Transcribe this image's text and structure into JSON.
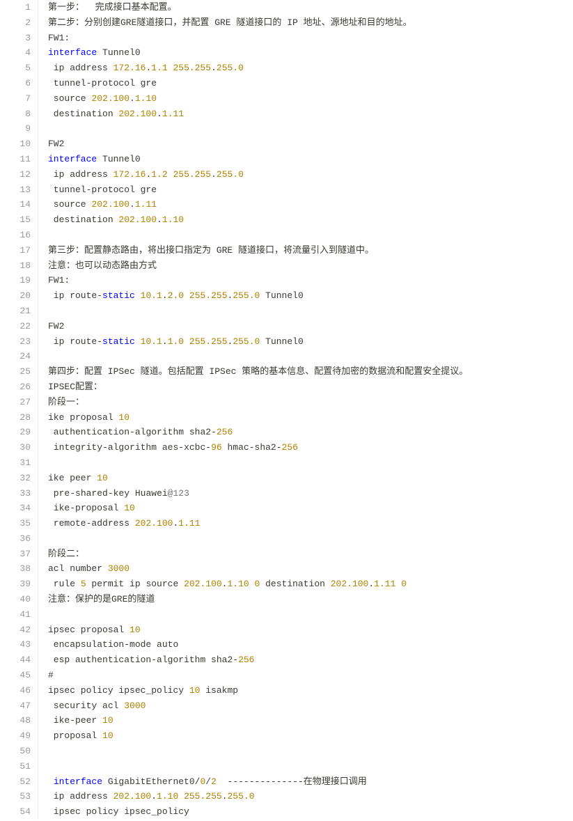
{
  "lines": [
    {
      "n": "1",
      "segs": [
        {
          "t": "第一步：  完成接口基本配置。"
        }
      ]
    },
    {
      "n": "2",
      "segs": [
        {
          "t": "第二步：分别创建GRE隧道接口，并配置 GRE 隧道接口的 IP 地址、源地址和目的地址。"
        }
      ]
    },
    {
      "n": "3",
      "segs": [
        {
          "t": "FW1"
        },
        {
          "t": ":",
          "c": "op"
        }
      ]
    },
    {
      "n": "4",
      "segs": [
        {
          "t": "interface",
          "c": "kw"
        },
        {
          "t": " Tunnel0"
        }
      ]
    },
    {
      "n": "5",
      "segs": [
        {
          "t": " ip address "
        },
        {
          "t": "172.16",
          "c": "num"
        },
        {
          "t": "."
        },
        {
          "t": "1.1",
          "c": "num"
        },
        {
          "t": " "
        },
        {
          "t": "255.255",
          "c": "num"
        },
        {
          "t": "."
        },
        {
          "t": "255.0",
          "c": "num"
        }
      ]
    },
    {
      "n": "6",
      "segs": [
        {
          "t": " tunnel"
        },
        {
          "t": "-"
        },
        {
          "t": "protocol gre"
        }
      ]
    },
    {
      "n": "7",
      "segs": [
        {
          "t": " source "
        },
        {
          "t": "202.100",
          "c": "num"
        },
        {
          "t": "."
        },
        {
          "t": "1.10",
          "c": "num"
        }
      ]
    },
    {
      "n": "8",
      "segs": [
        {
          "t": " destination "
        },
        {
          "t": "202.100",
          "c": "num"
        },
        {
          "t": "."
        },
        {
          "t": "1.11",
          "c": "num"
        }
      ]
    },
    {
      "n": "9",
      "segs": [
        {
          "t": ""
        }
      ]
    },
    {
      "n": "10",
      "segs": [
        {
          "t": "FW2"
        }
      ]
    },
    {
      "n": "11",
      "segs": [
        {
          "t": "interface",
          "c": "kw"
        },
        {
          "t": " Tunnel0"
        }
      ]
    },
    {
      "n": "12",
      "segs": [
        {
          "t": " ip address "
        },
        {
          "t": "172.16",
          "c": "num"
        },
        {
          "t": "."
        },
        {
          "t": "1.2",
          "c": "num"
        },
        {
          "t": " "
        },
        {
          "t": "255.255",
          "c": "num"
        },
        {
          "t": "."
        },
        {
          "t": "255.0",
          "c": "num"
        }
      ]
    },
    {
      "n": "13",
      "segs": [
        {
          "t": " tunnel"
        },
        {
          "t": "-"
        },
        {
          "t": "protocol gre"
        }
      ]
    },
    {
      "n": "14",
      "segs": [
        {
          "t": " source "
        },
        {
          "t": "202.100",
          "c": "num"
        },
        {
          "t": "."
        },
        {
          "t": "1.11",
          "c": "num"
        }
      ]
    },
    {
      "n": "15",
      "segs": [
        {
          "t": " destination "
        },
        {
          "t": "202.100",
          "c": "num"
        },
        {
          "t": "."
        },
        {
          "t": "1.10",
          "c": "num"
        }
      ]
    },
    {
      "n": "16",
      "segs": [
        {
          "t": ""
        }
      ]
    },
    {
      "n": "17",
      "segs": [
        {
          "t": "第三步：配置静态路由，将出接口指定为 GRE 隧道接口，将流量引入到隧道中。"
        }
      ]
    },
    {
      "n": "18",
      "segs": [
        {
          "t": "注意：也可以动态路由方式"
        }
      ]
    },
    {
      "n": "19",
      "segs": [
        {
          "t": "FW1"
        },
        {
          "t": ":",
          "c": "op"
        }
      ]
    },
    {
      "n": "20",
      "segs": [
        {
          "t": " ip route"
        },
        {
          "t": "-"
        },
        {
          "t": "static",
          "c": "kw"
        },
        {
          "t": " "
        },
        {
          "t": "10.1",
          "c": "num"
        },
        {
          "t": "."
        },
        {
          "t": "2.0",
          "c": "num"
        },
        {
          "t": " "
        },
        {
          "t": "255.255",
          "c": "num"
        },
        {
          "t": "."
        },
        {
          "t": "255.0",
          "c": "num"
        },
        {
          "t": " Tunnel0"
        }
      ]
    },
    {
      "n": "21",
      "segs": [
        {
          "t": ""
        }
      ]
    },
    {
      "n": "22",
      "segs": [
        {
          "t": "FW2"
        }
      ]
    },
    {
      "n": "23",
      "segs": [
        {
          "t": " ip route"
        },
        {
          "t": "-"
        },
        {
          "t": "static",
          "c": "kw"
        },
        {
          "t": " "
        },
        {
          "t": "10.1",
          "c": "num"
        },
        {
          "t": "."
        },
        {
          "t": "1.0",
          "c": "num"
        },
        {
          "t": " "
        },
        {
          "t": "255.255",
          "c": "num"
        },
        {
          "t": "."
        },
        {
          "t": "255.0",
          "c": "num"
        },
        {
          "t": " Tunnel0"
        }
      ]
    },
    {
      "n": "24",
      "segs": [
        {
          "t": ""
        }
      ]
    },
    {
      "n": "25",
      "segs": [
        {
          "t": "第四步：配置 IPSec 隧道。包括配置 IPSec 策略的基本信息、配置待加密的数据流和配置安全提议。"
        }
      ]
    },
    {
      "n": "26",
      "segs": [
        {
          "t": "IPSEC配置："
        }
      ]
    },
    {
      "n": "27",
      "segs": [
        {
          "t": "阶段一："
        }
      ]
    },
    {
      "n": "28",
      "segs": [
        {
          "t": "ike proposal "
        },
        {
          "t": "10",
          "c": "num"
        }
      ]
    },
    {
      "n": "29",
      "segs": [
        {
          "t": " authentication"
        },
        {
          "t": "-"
        },
        {
          "t": "algorithm sha2"
        },
        {
          "t": "-"
        },
        {
          "t": "256",
          "c": "num"
        }
      ]
    },
    {
      "n": "30",
      "segs": [
        {
          "t": " integrity"
        },
        {
          "t": "-"
        },
        {
          "t": "algorithm aes"
        },
        {
          "t": "-"
        },
        {
          "t": "xcbc"
        },
        {
          "t": "-"
        },
        {
          "t": "96",
          "c": "num"
        },
        {
          "t": " hmac"
        },
        {
          "t": "-"
        },
        {
          "t": "sha2"
        },
        {
          "t": "-"
        },
        {
          "t": "256",
          "c": "num"
        }
      ]
    },
    {
      "n": "31",
      "segs": [
        {
          "t": ""
        }
      ]
    },
    {
      "n": "32",
      "segs": [
        {
          "t": "ike peer "
        },
        {
          "t": "10",
          "c": "num"
        }
      ]
    },
    {
      "n": "33",
      "segs": [
        {
          "t": " pre"
        },
        {
          "t": "-"
        },
        {
          "t": "shared"
        },
        {
          "t": "-"
        },
        {
          "t": "key Huawei"
        },
        {
          "t": "@123",
          "c": "at"
        }
      ]
    },
    {
      "n": "34",
      "segs": [
        {
          "t": " ike"
        },
        {
          "t": "-"
        },
        {
          "t": "proposal "
        },
        {
          "t": "10",
          "c": "num"
        }
      ]
    },
    {
      "n": "35",
      "segs": [
        {
          "t": " remote"
        },
        {
          "t": "-"
        },
        {
          "t": "address "
        },
        {
          "t": "202.100",
          "c": "num"
        },
        {
          "t": "."
        },
        {
          "t": "1.11",
          "c": "num"
        }
      ]
    },
    {
      "n": "36",
      "segs": [
        {
          "t": ""
        }
      ]
    },
    {
      "n": "37",
      "segs": [
        {
          "t": "阶段二："
        }
      ]
    },
    {
      "n": "38",
      "segs": [
        {
          "t": "acl number "
        },
        {
          "t": "3000",
          "c": "num"
        }
      ]
    },
    {
      "n": "39",
      "segs": [
        {
          "t": " rule "
        },
        {
          "t": "5",
          "c": "num"
        },
        {
          "t": " permit ip source "
        },
        {
          "t": "202.100",
          "c": "num"
        },
        {
          "t": "."
        },
        {
          "t": "1.10",
          "c": "num"
        },
        {
          "t": " "
        },
        {
          "t": "0",
          "c": "num"
        },
        {
          "t": " destination "
        },
        {
          "t": "202.100",
          "c": "num"
        },
        {
          "t": "."
        },
        {
          "t": "1.11",
          "c": "num"
        },
        {
          "t": " "
        },
        {
          "t": "0",
          "c": "num"
        }
      ]
    },
    {
      "n": "40",
      "segs": [
        {
          "t": "注意：保护的是GRE的隧道"
        }
      ]
    },
    {
      "n": "41",
      "segs": [
        {
          "t": ""
        }
      ]
    },
    {
      "n": "42",
      "segs": [
        {
          "t": "ipsec proposal "
        },
        {
          "t": "10",
          "c": "num"
        }
      ]
    },
    {
      "n": "43",
      "segs": [
        {
          "t": " encapsulation"
        },
        {
          "t": "-"
        },
        {
          "t": "mode auto"
        }
      ]
    },
    {
      "n": "44",
      "segs": [
        {
          "t": " esp authentication"
        },
        {
          "t": "-"
        },
        {
          "t": "algorithm sha2"
        },
        {
          "t": "-"
        },
        {
          "t": "256",
          "c": "num"
        }
      ]
    },
    {
      "n": "45",
      "segs": [
        {
          "t": "#"
        }
      ]
    },
    {
      "n": "46",
      "segs": [
        {
          "t": "ipsec policy ipsec_policy "
        },
        {
          "t": "10",
          "c": "num"
        },
        {
          "t": " isakmp"
        }
      ]
    },
    {
      "n": "47",
      "segs": [
        {
          "t": " security acl "
        },
        {
          "t": "3000",
          "c": "num"
        }
      ]
    },
    {
      "n": "48",
      "segs": [
        {
          "t": " ike"
        },
        {
          "t": "-"
        },
        {
          "t": "peer "
        },
        {
          "t": "10",
          "c": "num"
        }
      ]
    },
    {
      "n": "49",
      "segs": [
        {
          "t": " proposal "
        },
        {
          "t": "10",
          "c": "num"
        }
      ]
    },
    {
      "n": "50",
      "segs": [
        {
          "t": ""
        }
      ]
    },
    {
      "n": "51",
      "segs": [
        {
          "t": ""
        }
      ]
    },
    {
      "n": "52",
      "segs": [
        {
          "t": " "
        },
        {
          "t": "interface",
          "c": "kw"
        },
        {
          "t": " GigabitEthernet0"
        },
        {
          "t": "/",
          "c": "op"
        },
        {
          "t": "0",
          "c": "num"
        },
        {
          "t": "/",
          "c": "op"
        },
        {
          "t": "2",
          "c": "num"
        },
        {
          "t": "  "
        },
        {
          "t": "--------------",
          "c": "op"
        },
        {
          "t": "在物理接口调用"
        }
      ]
    },
    {
      "n": "53",
      "segs": [
        {
          "t": " ip address "
        },
        {
          "t": "202.100",
          "c": "num"
        },
        {
          "t": "."
        },
        {
          "t": "1.10",
          "c": "num"
        },
        {
          "t": " "
        },
        {
          "t": "255.255",
          "c": "num"
        },
        {
          "t": "."
        },
        {
          "t": "255.0",
          "c": "num"
        }
      ]
    },
    {
      "n": "54",
      "segs": [
        {
          "t": " ipsec policy ipsec_policy"
        }
      ]
    }
  ]
}
